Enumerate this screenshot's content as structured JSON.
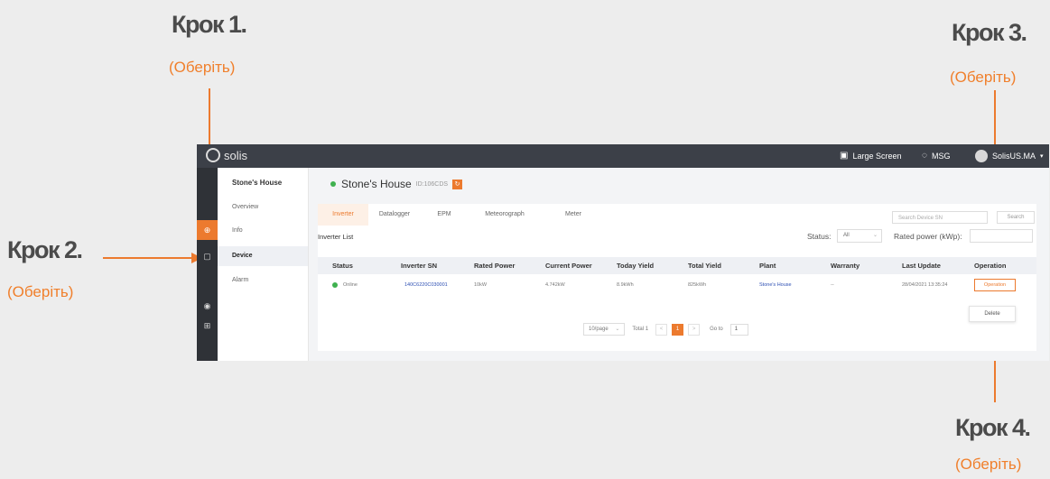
{
  "annotations": {
    "step1": {
      "label": "Крок 1.",
      "sub": "(Оберіть)"
    },
    "step2": {
      "label": "Крок 2.",
      "sub": "(Оберіть)"
    },
    "step3": {
      "label": "Крок 3.",
      "sub": "(Оберіть)"
    },
    "step4": {
      "label": "Крок 4.",
      "sub": "(Оберіть)"
    }
  },
  "colors": {
    "accent": "#ec7a2e",
    "online": "#3fb14f",
    "topbar": "#3c4048"
  },
  "topbar": {
    "logo_text": "solis",
    "large_screen": "Large Screen",
    "msg": "MSG",
    "user": "SolisUS.MA"
  },
  "iconbar": {
    "items": [
      {
        "icon": "plant-icon",
        "glyph": "⊕"
      },
      {
        "icon": "device-icon",
        "glyph": "▢"
      },
      {
        "icon": "eye-icon",
        "glyph": "◉"
      },
      {
        "icon": "grid-icon",
        "glyph": "⊞"
      }
    ]
  },
  "submenu": {
    "title": "Stone's House",
    "items": [
      "Overview",
      "Info",
      "Device",
      "Alarm"
    ]
  },
  "page": {
    "title": "Stone's House",
    "id": "ID:106CDS",
    "badge_glyph": "↻"
  },
  "tabs": [
    "Inverter",
    "Datalogger",
    "EPM",
    "Meteorograph",
    "Meter"
  ],
  "search": {
    "placeholder": "Search Device SN",
    "button": "Search"
  },
  "list": {
    "title": "Inverter List",
    "status_label": "Status:",
    "status_value": "All",
    "rated_label": "Rated power (kWp):"
  },
  "table": {
    "headers": [
      "Status",
      "Inverter SN",
      "Rated Power",
      "Current Power",
      "Today Yield",
      "Total Yield",
      "Plant",
      "Warranty",
      "Last Update",
      "Operation"
    ],
    "row": {
      "status": "Online",
      "sn": "140C6220C030001",
      "rated": "10kW",
      "current": "4.742kW",
      "today": "8.9kWh",
      "total": "825kWh",
      "plant": "Stone's House",
      "warranty": "--",
      "last_update": "28/04/2021 13:35:24",
      "operation": "Operation"
    },
    "popup_delete": "Delete"
  },
  "pager": {
    "per_page": "10/page",
    "total": "Total 1",
    "prev": "<",
    "page": "1",
    "next": ">",
    "goto_label": "Go to",
    "goto_value": "1"
  }
}
